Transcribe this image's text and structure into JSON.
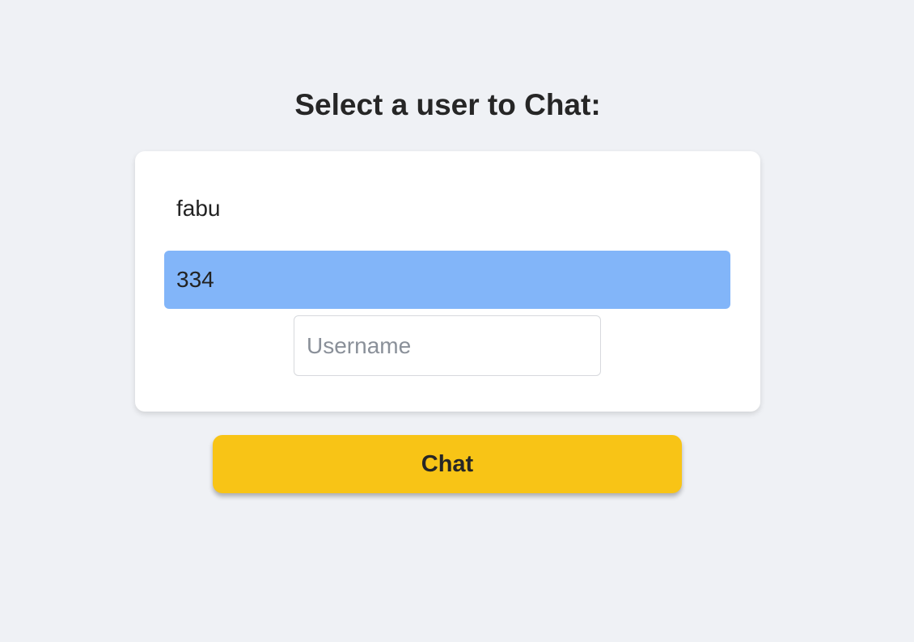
{
  "page": {
    "title": "Select a user to Chat:"
  },
  "users": {
    "items": [
      {
        "label": "fabu",
        "selected": false
      },
      {
        "label": "334",
        "selected": true
      }
    ]
  },
  "username_field": {
    "value": "",
    "placeholder": "Username"
  },
  "chat_button": {
    "label": "Chat"
  },
  "colors": {
    "background": "#eff1f5",
    "card": "#ffffff",
    "selected_item": "#82b5f9",
    "button": "#f8c416",
    "text": "#222222",
    "placeholder": "#8a9099"
  }
}
